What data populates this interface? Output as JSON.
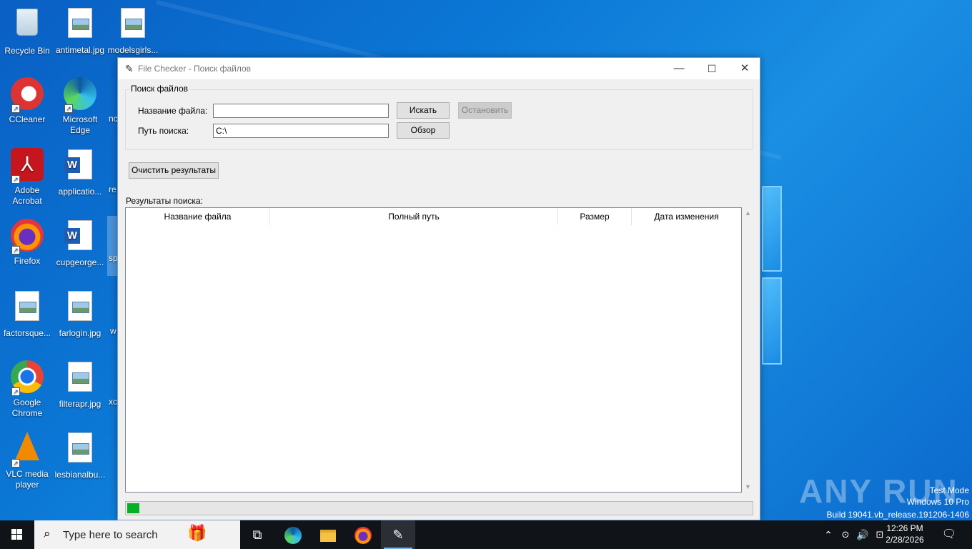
{
  "desktop": {
    "icons": [
      {
        "label": "Recycle Bin",
        "icon": "recycle-bin-icon"
      },
      {
        "label": "antimetal.jpg",
        "icon": "image-file-icon"
      },
      {
        "label": "modelsgirls...",
        "icon": "image-file-icon"
      },
      {
        "label": "CCleaner",
        "icon": "ccleaner-icon"
      },
      {
        "label": "Microsoft Edge",
        "icon": "edge-icon"
      },
      {
        "label": "nc",
        "icon": "file-icon"
      },
      {
        "label": "Adobe Acrobat",
        "icon": "acrobat-icon"
      },
      {
        "label": "applicatio...",
        "icon": "word-doc-icon"
      },
      {
        "label": "re",
        "icon": "file-icon"
      },
      {
        "label": "Firefox",
        "icon": "firefox-icon"
      },
      {
        "label": "cupgeorge...",
        "icon": "word-doc-icon"
      },
      {
        "label": "sp",
        "icon": "file-icon"
      },
      {
        "label": "factorsque...",
        "icon": "image-file-icon"
      },
      {
        "label": "farlogin.jpg",
        "icon": "image-file-icon"
      },
      {
        "label": "w",
        "icon": "file-icon"
      },
      {
        "label": "Google Chrome",
        "icon": "chrome-icon"
      },
      {
        "label": "filterapr.jpg",
        "icon": "image-file-icon"
      },
      {
        "label": "xc",
        "icon": "file-icon"
      },
      {
        "label": "VLC media player",
        "icon": "vlc-icon"
      },
      {
        "label": "lesbianalbu...",
        "icon": "image-file-icon"
      }
    ]
  },
  "window": {
    "title": "File Checker - Поиск файлов",
    "controls": {
      "minimize": "—",
      "maximize": "☐",
      "close": "✕"
    },
    "search_group": {
      "legend": "Поиск файлов",
      "filename_label": "Название файла:",
      "filename_value": "",
      "path_label": "Путь поиска:",
      "path_value": "C:\\",
      "search_button": "Искать",
      "stop_button": "Остановить",
      "browse_button": "Обзор"
    },
    "clear_button": "Очистить результаты",
    "results_label": "Результаты поиска:",
    "results_columns": [
      "Название файла",
      "Полный путь",
      "Размер",
      "Дата изменения"
    ],
    "results_rows": [],
    "progress_percent": 2,
    "progress_color": "#06b025"
  },
  "taskbar": {
    "search_placeholder": "Type here to search",
    "pinned": [
      "task-view-icon",
      "edge-icon",
      "file-explorer-icon",
      "firefox-icon",
      "python-feather-icon"
    ],
    "time": "12:26 PM",
    "date": "2/28/2026"
  },
  "watermark": {
    "brand": "ANY RUN",
    "line1": "Test Mode",
    "line2": "Windows 10 Pro",
    "line3": "Build 19041.vb_release.191206-1406"
  }
}
